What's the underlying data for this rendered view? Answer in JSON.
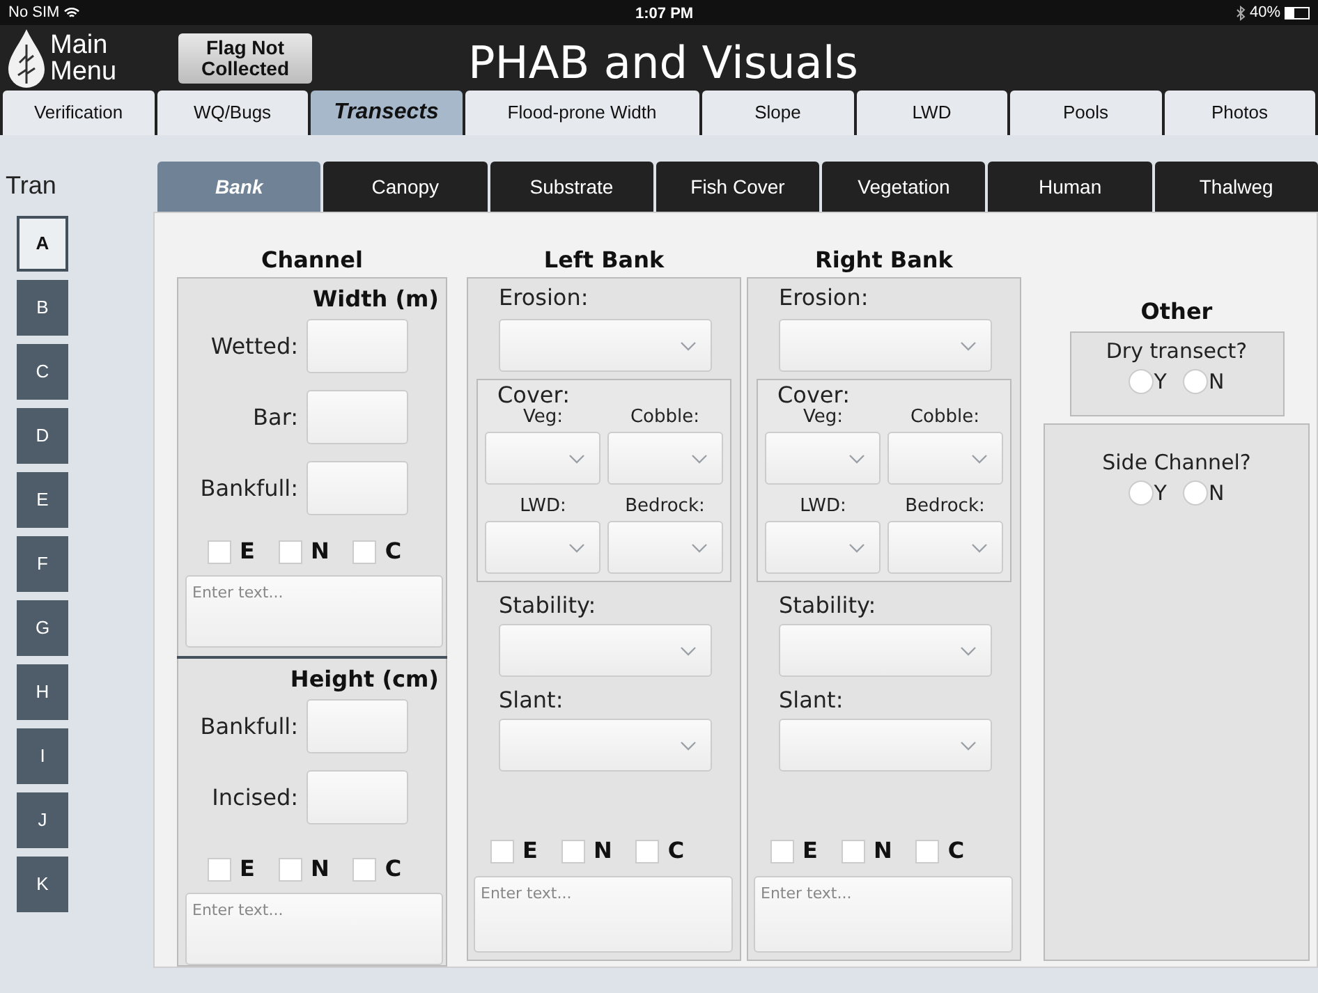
{
  "status_bar": {
    "carrier": "No SIM",
    "time": "1:07 PM",
    "battery": "40%"
  },
  "header": {
    "menu_label": "Main Menu",
    "flag_button": "Flag Not Collected",
    "title": "PHAB and Visuals"
  },
  "tabs": [
    {
      "label": "Verification",
      "selected": false
    },
    {
      "label": "WQ/Bugs",
      "selected": false
    },
    {
      "label": "Transects",
      "selected": true
    },
    {
      "label": "Flood-prone Width",
      "selected": false
    },
    {
      "label": "Slope",
      "selected": false
    },
    {
      "label": "LWD",
      "selected": false
    },
    {
      "label": "Pools",
      "selected": false
    },
    {
      "label": "Photos",
      "selected": false
    }
  ],
  "transect_label": "Tran",
  "subtabs": [
    {
      "label": "Bank",
      "selected": true
    },
    {
      "label": "Canopy",
      "selected": false
    },
    {
      "label": "Substrate",
      "selected": false
    },
    {
      "label": "Fish Cover",
      "selected": false
    },
    {
      "label": "Vegetation",
      "selected": false
    },
    {
      "label": "Human",
      "selected": false
    },
    {
      "label": "Thalweg",
      "selected": false
    }
  ],
  "transects": [
    {
      "label": "A",
      "selected": true
    },
    {
      "label": "B",
      "selected": false
    },
    {
      "label": "C",
      "selected": false
    },
    {
      "label": "D",
      "selected": false
    },
    {
      "label": "E",
      "selected": false
    },
    {
      "label": "F",
      "selected": false
    },
    {
      "label": "G",
      "selected": false
    },
    {
      "label": "H",
      "selected": false
    },
    {
      "label": "I",
      "selected": false
    },
    {
      "label": "J",
      "selected": false
    },
    {
      "label": "K",
      "selected": false
    }
  ],
  "channel": {
    "title": "Channel",
    "sections": [
      {
        "heading": "Width (m)",
        "fields": [
          {
            "label": "Wetted:"
          },
          {
            "label": "Bar:"
          },
          {
            "label": "Bankfull:"
          }
        ],
        "checks": [
          {
            "label": "E",
            "checked": false
          },
          {
            "label": "N",
            "checked": false
          },
          {
            "label": "C",
            "checked": false
          }
        ],
        "notes": {
          "placeholder": "Enter text..."
        }
      },
      {
        "heading": "Height (cm)",
        "fields": [
          {
            "label": "Bankfull:"
          },
          {
            "label": "Incised:"
          }
        ],
        "checks": [
          {
            "label": "E",
            "checked": false
          },
          {
            "label": "N",
            "checked": false
          },
          {
            "label": "C",
            "checked": false
          }
        ],
        "notes": {
          "placeholder": "Enter text..."
        }
      }
    ]
  },
  "banks": [
    {
      "title": "Left Bank",
      "erosion": "Erosion:",
      "cover": {
        "label": "Cover:",
        "fields": [
          "Veg:",
          "Cobble:",
          "LWD:",
          "Bedrock:"
        ]
      },
      "stability": "Stability:",
      "slant": "Slant:",
      "checks": [
        {
          "label": "E",
          "checked": false
        },
        {
          "label": "N",
          "checked": false
        },
        {
          "label": "C",
          "checked": false
        }
      ],
      "notes": {
        "placeholder": "Enter text..."
      }
    },
    {
      "title": "Right Bank",
      "erosion": "Erosion:",
      "cover": {
        "label": "Cover:",
        "fields": [
          "Veg:",
          "Cobble:",
          "LWD:",
          "Bedrock:"
        ]
      },
      "stability": "Stability:",
      "slant": "Slant:",
      "checks": [
        {
          "label": "E",
          "checked": false
        },
        {
          "label": "N",
          "checked": false
        },
        {
          "label": "C",
          "checked": false
        }
      ],
      "notes": {
        "placeholder": "Enter text..."
      }
    }
  ],
  "other": {
    "title": "Other",
    "questions": [
      {
        "label": "Dry transect?",
        "options": [
          {
            "label": "Y",
            "selected": false
          },
          {
            "label": "N",
            "selected": false
          }
        ]
      },
      {
        "label": "Side Channel?",
        "options": [
          {
            "label": "Y",
            "selected": false
          },
          {
            "label": "N",
            "selected": false
          }
        ]
      }
    ]
  }
}
